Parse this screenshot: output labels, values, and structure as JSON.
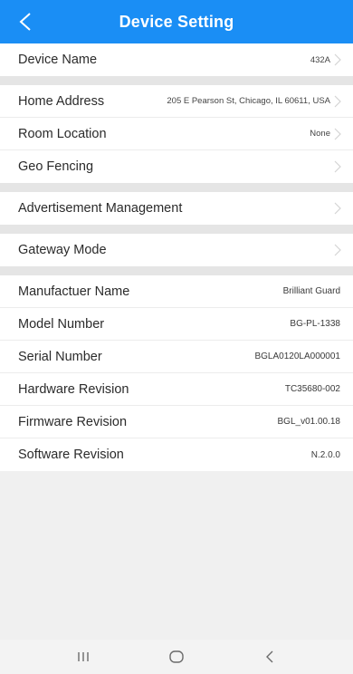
{
  "header": {
    "title": "Device Setting"
  },
  "groups": {
    "device": {
      "name_label": "Device Name",
      "name_value": "432A"
    },
    "location": {
      "address_label": "Home Address",
      "address_value": "205 E Pearson St, Chicago, IL 60611, USA",
      "room_label": "Room Location",
      "room_value": "None",
      "geo_label": "Geo Fencing"
    },
    "ads": {
      "label": "Advertisement Management"
    },
    "gateway": {
      "label": "Gateway Mode"
    },
    "info": [
      {
        "label": "Manufactuer Name",
        "value": "Brilliant Guard"
      },
      {
        "label": "Model Number",
        "value": "BG-PL-1338"
      },
      {
        "label": "Serial Number",
        "value": "BGLA0120LA000001"
      },
      {
        "label": "Hardware Revision",
        "value": "TC35680-002"
      },
      {
        "label": "Firmware Revision",
        "value": "BGL_v01.00.18"
      },
      {
        "label": "Software Revision",
        "value": "N.2.0.0"
      }
    ]
  },
  "colors": {
    "header_bg": "#1a8ef5",
    "page_bg": "#f0f0f0",
    "separator": "#e5e5e5"
  },
  "icons": {
    "back": "chevron-left-icon",
    "row_arrow": "chevron-right-icon",
    "nav_recents": "recent-apps-icon",
    "nav_home": "home-icon",
    "nav_back": "back-icon"
  }
}
